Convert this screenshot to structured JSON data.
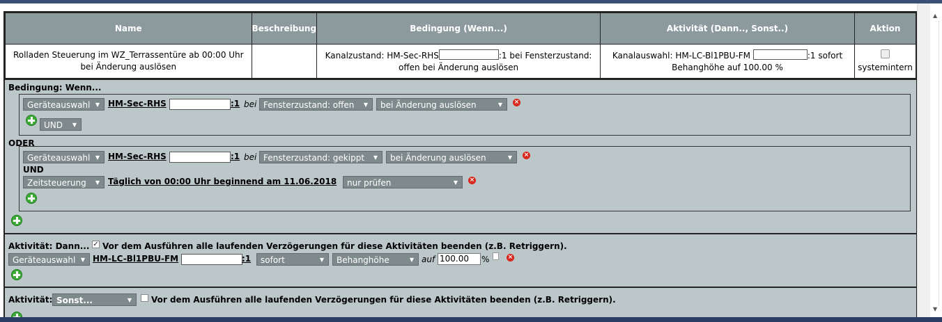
{
  "table": {
    "headers": [
      "Name",
      "Beschreibung",
      "Bedingung (Wenn...)",
      "Aktivität (Dann.., Sonst..)",
      "Aktion"
    ],
    "row": {
      "name_line1": "Rolladen Steuerung im WZ_Terrassentüre ab 00:00 Uhr",
      "name_line2": "bei Änderung auslösen",
      "description": "",
      "condition_prefix": "Kanalzustand: HM-Sec-RHS",
      "condition_suffix": ":1 bei Fensterzustand:",
      "condition_line2": "offen bei Änderung auslösen",
      "activity_prefix": "Kanalauswahl: HM-LC-Bl1PBU-FM",
      "activity_suffix": ":1 sofort",
      "activity_line2": "Behanghöhe auf 100.00 %",
      "action_label": "systemintern"
    }
  },
  "condition_section": {
    "title": "Bedingung: Wenn...",
    "group1": {
      "device_select": "Geräteauswahl",
      "device_name": "HM-Sec-RHS",
      "channel": ":1",
      "bei": "bei",
      "state_select": "Fensterzustand: offen",
      "trigger_select": "bei Änderung auslösen",
      "operator_select": "UND"
    },
    "or_label": "ODER",
    "group2": {
      "device_select": "Geräteauswahl",
      "device_name": "HM-Sec-RHS",
      "channel": ":1",
      "bei": "bei",
      "state_select": "Fensterzustand: gekippt",
      "trigger_select": "bei Änderung auslösen",
      "and_label": "UND",
      "time_select": "Zeitsteuerung",
      "time_text": "Täglich von 00:00 Uhr beginnend am 11.06.2018",
      "check_select": "nur prüfen"
    }
  },
  "then_section": {
    "title": "Aktivität: Dann...",
    "retrigger_text": "Vor dem Ausführen alle laufenden Verzögerungen für diese Aktivitäten beenden (z.B. Retriggern).",
    "device_select": "Geräteauswahl",
    "device_name": "HM-LC-Bl1PBU-FM",
    "channel": ":1",
    "timing_select": "sofort",
    "param_select": "Behanghöhe",
    "auf": "auf",
    "value": "100.00",
    "unit": "%"
  },
  "else_section": {
    "title": "Aktivität:",
    "mode_select": "Sonst...",
    "retrigger_text": "Vor dem Ausführen alle laufenden Verzögerungen für diese Aktivitäten beenden (z.B. Retriggern)."
  }
}
